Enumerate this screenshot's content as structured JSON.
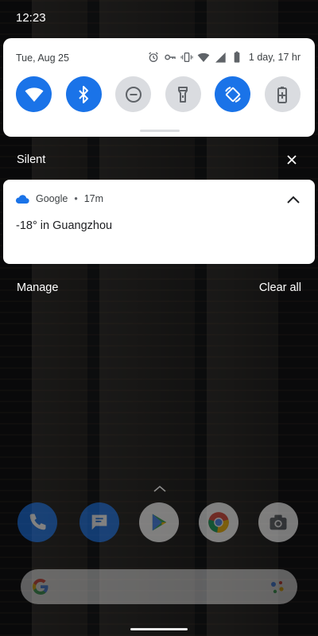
{
  "status_bar": {
    "time": "12:23"
  },
  "quick_settings": {
    "date": "Tue, Aug 25",
    "battery_text": "1 day, 17 hr",
    "status_icons": [
      "alarm-icon",
      "key-icon",
      "vibrate-icon",
      "wifi-signal-icon",
      "cell-signal-icon",
      "battery-icon"
    ],
    "tiles": [
      {
        "name": "wifi",
        "icon": "wifi-icon",
        "active": true
      },
      {
        "name": "bluetooth",
        "icon": "bluetooth-icon",
        "active": true
      },
      {
        "name": "do-not-disturb",
        "icon": "dnd-icon",
        "active": false
      },
      {
        "name": "flashlight",
        "icon": "flashlight-icon",
        "active": false
      },
      {
        "name": "auto-rotate",
        "icon": "rotate-icon",
        "active": true
      },
      {
        "name": "battery-saver",
        "icon": "battery-saver-icon",
        "active": false
      }
    ],
    "accent_color": "#1a73e8"
  },
  "section": {
    "title": "Silent"
  },
  "notification": {
    "app": "Google",
    "separator": "•",
    "time": "17m",
    "text": "-18° in Guangzhou"
  },
  "actions": {
    "manage": "Manage",
    "clear_all": "Clear all"
  },
  "home": {
    "dock": [
      "phone-icon",
      "messages-icon",
      "play-store-icon",
      "chrome-icon",
      "camera-icon"
    ]
  }
}
